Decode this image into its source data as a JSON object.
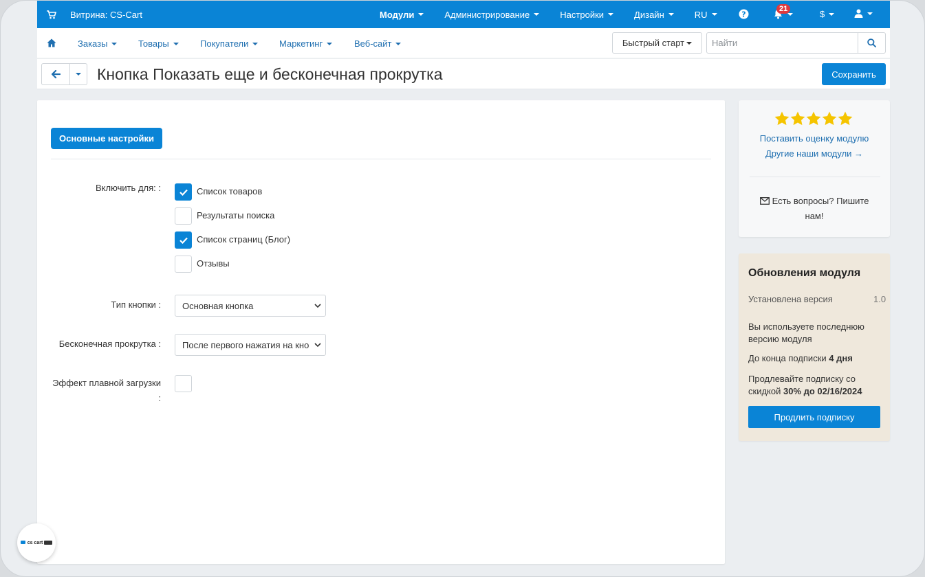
{
  "topbar": {
    "storefront": "Витрина: CS-Cart",
    "menu": [
      {
        "label": "Модули",
        "bold": true
      },
      {
        "label": "Администрирование",
        "bold": false
      },
      {
        "label": "Настройки",
        "bold": false
      },
      {
        "label": "Дизайн",
        "bold": false
      },
      {
        "label": "RU",
        "bold": false
      }
    ],
    "notifications_count": "21",
    "currency": "$"
  },
  "navbar": {
    "items": [
      "Заказы",
      "Товары",
      "Покупатели",
      "Маркетинг",
      "Веб-сайт"
    ],
    "quick_start": "Быстрый старт",
    "search_placeholder": "Найти"
  },
  "titlebar": {
    "title": "Кнопка Показать еще и бесконечная прокрутка",
    "save": "Сохранить"
  },
  "main": {
    "tab": "Основные настройки",
    "enable_label": "Включить для: :",
    "checkboxes": [
      {
        "label": "Список товаров",
        "checked": true
      },
      {
        "label": "Результаты поиска",
        "checked": false
      },
      {
        "label": "Список страниц (Блог)",
        "checked": true
      },
      {
        "label": "Отзывы",
        "checked": false
      }
    ],
    "button_type_label": "Тип кнопки :",
    "button_type_value": "Основная кнопка",
    "infinite_label": "Бесконечная прокрутка :",
    "infinite_value": "После первого нажатия на кнопку",
    "smooth_label_1": "Эффект плавной загрузки",
    "smooth_label_2": ":",
    "smooth_checked": false
  },
  "rating_card": {
    "rate": "Поставить оценку модулю",
    "other": "Другие наши модули →",
    "questions": "Есть вопросы? Пишите нам!"
  },
  "update_card": {
    "title": "Обновления модуля",
    "installed_label": "Установлена версия",
    "installed_value": "1.0",
    "latest": "Вы используете последнюю версию модуля",
    "sub_prefix": "До конца подписки",
    "sub_days": "4 дня",
    "renew_prefix": "Продлевайте подписку со скидкой",
    "renew_bold": "30% до 02/16/2024",
    "renew_button": "Продлить подписку"
  },
  "logo_text": "cs cart",
  "colors": {
    "primary": "#0a84d6",
    "badge": "#e0393e",
    "star": "#f5c400",
    "update_bg": "#efe8dc"
  }
}
